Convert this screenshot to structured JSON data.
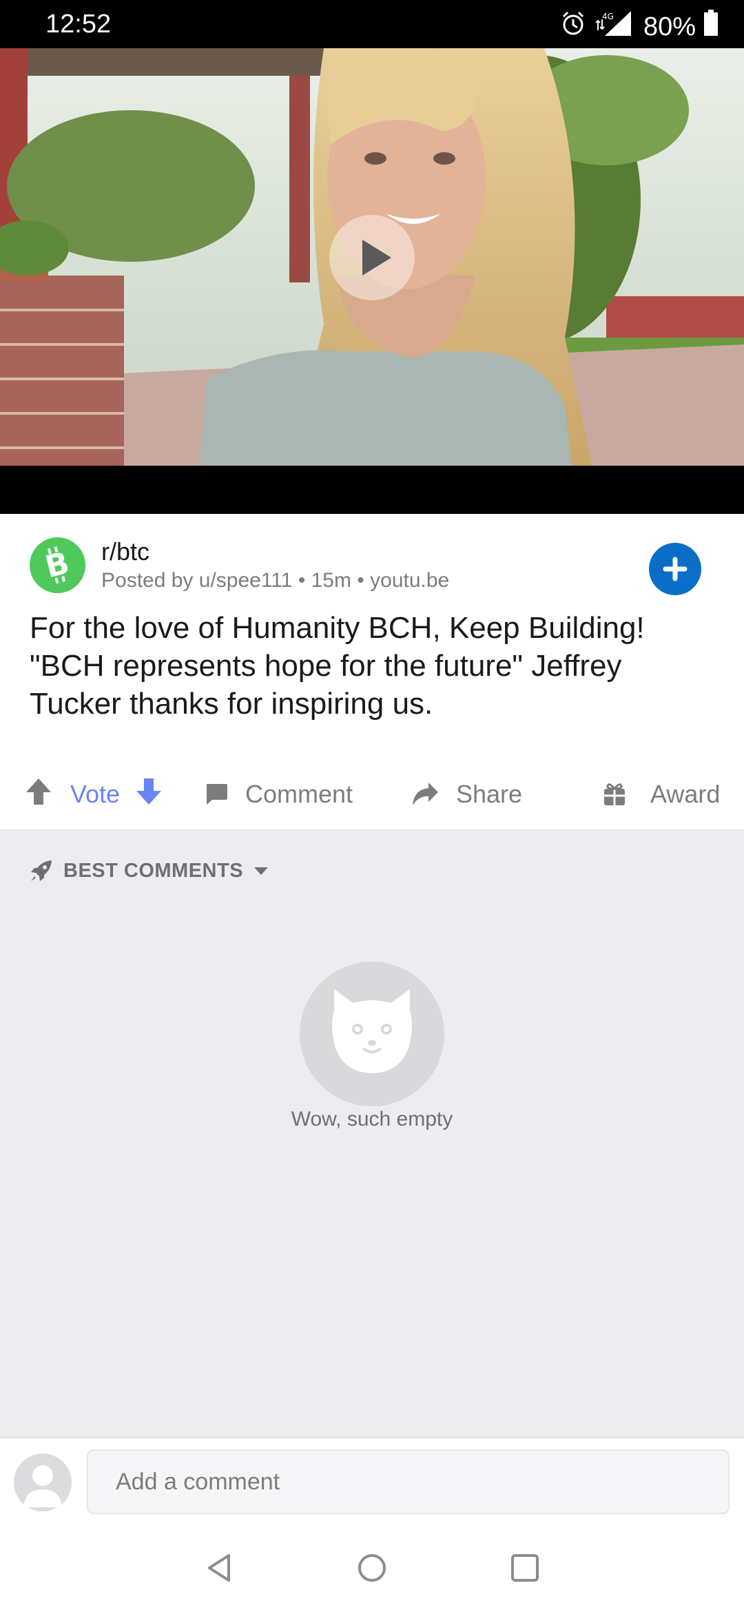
{
  "status_bar": {
    "time": "12:52",
    "network": "4G",
    "battery": "80%",
    "icons": [
      "alarm-icon",
      "signal-icon",
      "battery-icon"
    ]
  },
  "video": {
    "play_icon": "play-icon"
  },
  "post": {
    "subreddit": "r/btc",
    "meta": "Posted by u/spee111 • 15m • youtu.be",
    "title": "For the love of Humanity BCH, Keep Building! \"BCH represents hope for the future\" Jeffrey Tucker thanks for inspiring us.",
    "subreddit_icon": "bitcoin-cash-icon",
    "join_icon": "plus-icon"
  },
  "actions": {
    "vote": "Vote",
    "comment": "Comment",
    "share": "Share",
    "award": "Award"
  },
  "comments": {
    "sort_label": "BEST COMMENTS",
    "empty_text": "Wow, such empty",
    "composer_placeholder": "Add a comment"
  },
  "colors": {
    "join_blue": "#0a6ec7",
    "vote_blue": "#6a84f3",
    "subreddit_green": "#4ec95a"
  }
}
